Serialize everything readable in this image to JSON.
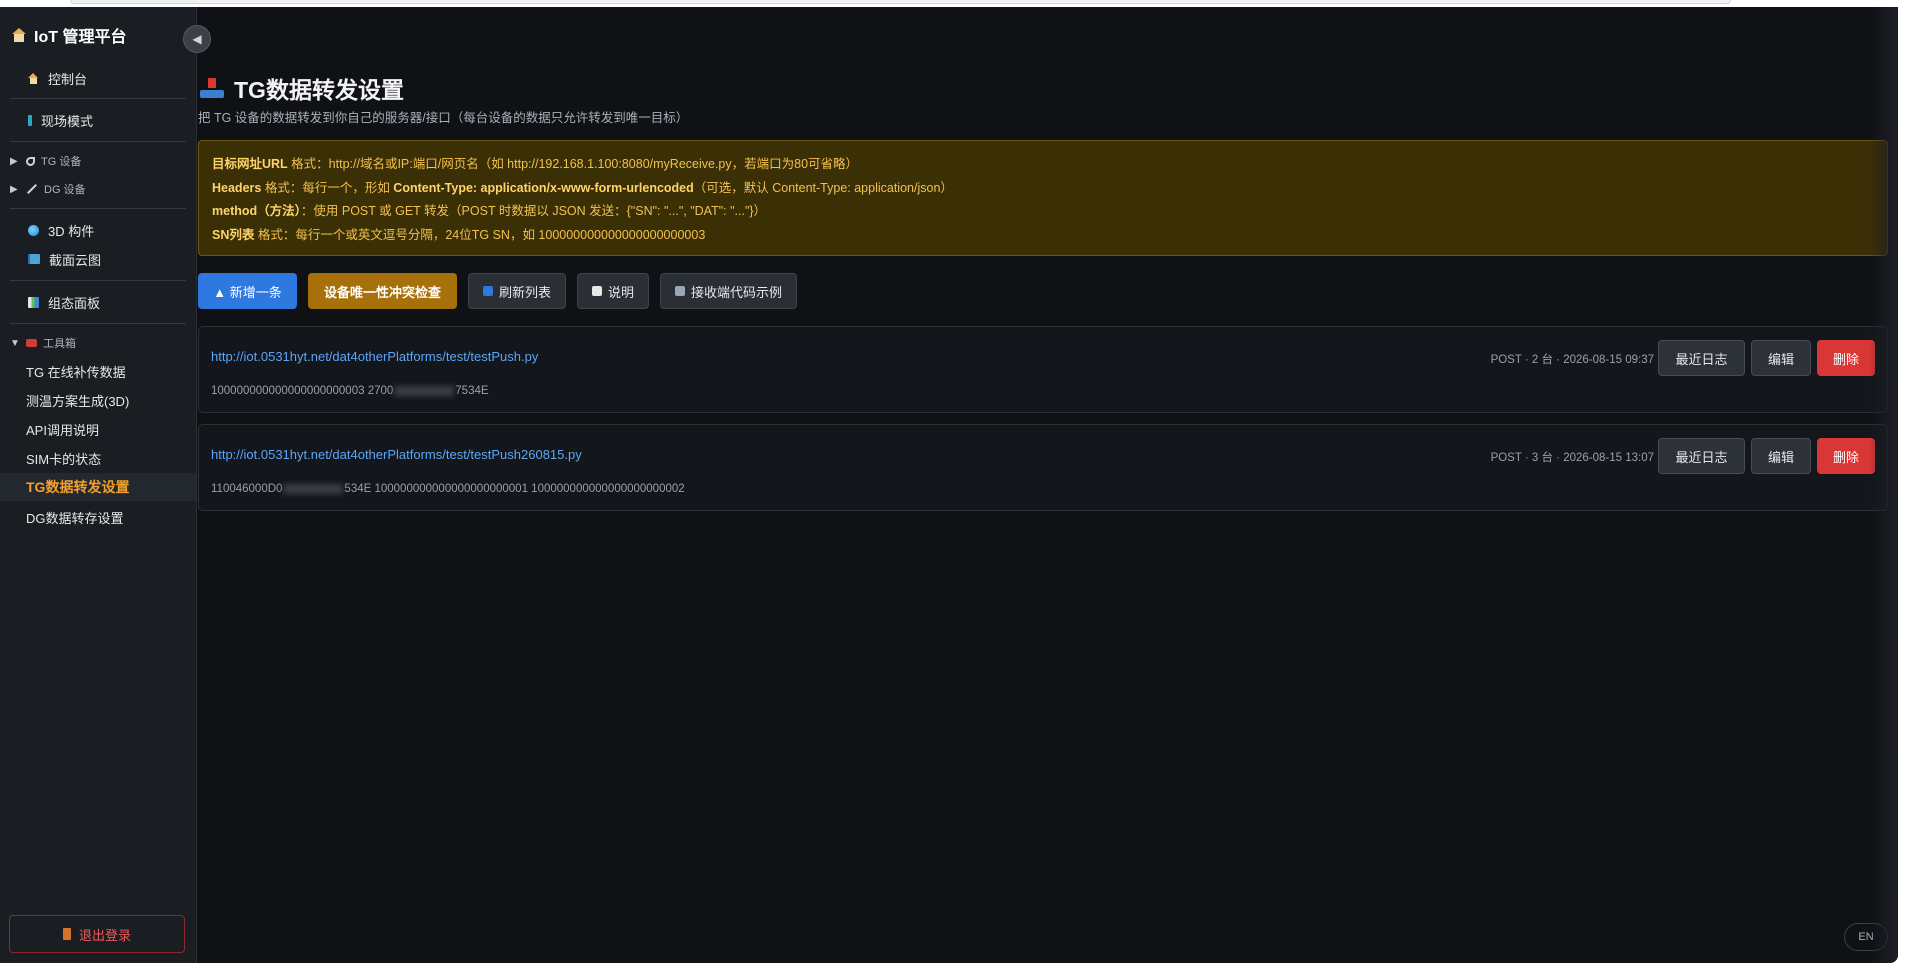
{
  "app": {
    "title": "IoT 管理平台",
    "collapse_icon": "◀"
  },
  "sidebar": {
    "items": [
      {
        "label": "控制台",
        "icon": "house-icon"
      },
      {
        "label": "现场模式",
        "icon": "bar-icon"
      }
    ],
    "groups": [
      {
        "label": "TG 设备",
        "expanded": false
      },
      {
        "label": "DG 设备",
        "expanded": false
      }
    ],
    "tools": [
      {
        "label": "3D 构件",
        "icon": "globe-icon"
      },
      {
        "label": "截面云图",
        "icon": "book-icon"
      }
    ],
    "panel": {
      "label": "组态面板",
      "icon": "chart-icon"
    },
    "toolbox": {
      "label": "工具箱",
      "expanded": true,
      "items": [
        {
          "label": "TG 在线补传数据"
        },
        {
          "label": "测温方案生成(3D)"
        },
        {
          "label": "API调用说明"
        },
        {
          "label": "SIM卡的状态"
        },
        {
          "label": "TG数据转发设置",
          "active": true
        },
        {
          "label": "DG数据转存设置"
        }
      ]
    },
    "logout_label": "退出登录"
  },
  "page": {
    "title": "TG数据转发设置",
    "subtitle": "把 TG 设备的数据转发到你自己的服务器/接口（每台设备的数据只允许转发到唯一目标）"
  },
  "notice": {
    "line1_key": "目标网址URL",
    "line1_text": " 格式：http://域名或IP:端口/网页名（如 http://192.168.1.100:8080/myReceive.py，若端口为80可省略）",
    "line2_key": "Headers",
    "line2_text_a": " 格式：每行一个，形如 ",
    "line2_bold": "Content-Type: application/x-www-form-urlencoded",
    "line2_text_b": "（可选，默认 Content-Type: application/json）",
    "line3_key": "method（方法）",
    "line3_text": "：使用 POST 或 GET 转发（POST 时数据以 JSON 发送：{\"SN\": \"...\", \"DAT\": \"...\"}）",
    "line4_key": "SN列表",
    "line4_text": " 格式：每行一个或英文逗号分隔，24位TG SN，如 100000000000000000000003"
  },
  "actions": {
    "add": "▲ 新增一条",
    "conflict_check": "设备唯一性冲突检查",
    "refresh": "刷新列表",
    "help": "说明",
    "code_example": "接收端代码示例"
  },
  "rules": [
    {
      "url": "http://iot.0531hyt.net/dat4otherPlatforms/test/testPush.py",
      "sns_a": "100000000000000000000003 2700",
      "sns_b": "7534E",
      "meta": "POST · 2 台 · 2026-08-15 09:37",
      "log": "最近日志",
      "edit": "编辑",
      "delete": "删除"
    },
    {
      "url": "http://iot.0531hyt.net/dat4otherPlatforms/test/testPush260815.py",
      "sns_a": "110046000D0",
      "sns_b": "534E 100000000000000000000001 100000000000000000000002",
      "meta": "POST · 3 台 · 2026-08-15 13:07",
      "log": "最近日志",
      "edit": "编辑",
      "delete": "删除"
    }
  ],
  "lang_label": "EN",
  "colors": {
    "accent_blue": "#2f78e0",
    "accent_gold": "#a8700a",
    "danger": "#d93636",
    "active_nav": "#f0a030",
    "link": "#5ba6f5"
  }
}
